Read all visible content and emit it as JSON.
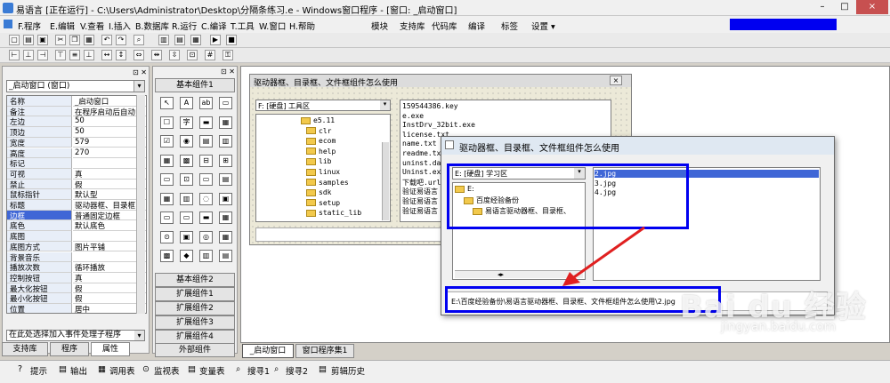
{
  "window": {
    "title": "易语言 [正在运行] - C:\\Users\\Administrator\\Desktop\\分隔条练习.e - Windows窗口程序 - [窗口: _启动窗口]",
    "controls": [
      "–",
      "□",
      "×"
    ]
  },
  "menu": {
    "items": [
      "F.程序",
      "E.编辑",
      "V.查看",
      "I.插入",
      "B.数据库",
      "R.运行",
      "C.编译",
      "T.工具",
      "W.窗口",
      "H.帮助"
    ],
    "right_items": [
      "模块",
      "支持库",
      "代码库",
      "编译",
      "标签",
      "设置 ▾"
    ]
  },
  "properties": {
    "selector": "_启动窗口 (窗口)",
    "rows": [
      {
        "k": "名称",
        "v": "_启动窗口"
      },
      {
        "k": "备注",
        "v": "在程序启动后自动"
      },
      {
        "k": "左边",
        "v": "50"
      },
      {
        "k": "顶边",
        "v": "50"
      },
      {
        "k": "宽度",
        "v": "579"
      },
      {
        "k": "高度",
        "v": "270"
      },
      {
        "k": "标记",
        "v": ""
      },
      {
        "k": "可视",
        "v": "真"
      },
      {
        "k": "禁止",
        "v": "假"
      },
      {
        "k": "鼠标指针",
        "v": "默认型"
      },
      {
        "k": "标题",
        "v": "驱动器框、目录框"
      },
      {
        "k": "边框",
        "v": "普通固定边框",
        "selected": true
      },
      {
        "k": "底色",
        "v": "默认底色"
      },
      {
        "k": "底图",
        "v": ""
      },
      {
        "k": "底图方式",
        "v": "图片平铺"
      },
      {
        "k": "背景音乐",
        "v": ""
      },
      {
        "k": "播放次数",
        "v": "循环播放"
      },
      {
        "k": "控制按钮",
        "v": "真"
      },
      {
        "k": "最大化按钮",
        "v": "假"
      },
      {
        "k": "最小化按钮",
        "v": "假"
      },
      {
        "k": "位置",
        "v": "居中"
      }
    ],
    "event_selector": "在此处选择加入事件处理子程序",
    "tabs": [
      "支持库",
      "程序",
      "属性"
    ]
  },
  "components": {
    "groups_top": "基本组件1",
    "groups_bottom": [
      "基本组件2",
      "扩展组件1",
      "扩展组件2",
      "扩展组件3",
      "扩展组件4",
      "外部组件"
    ]
  },
  "design_form": {
    "title": "驱动器框、目录框、文件框组件怎么使用",
    "drive": "F: [硬盘] 工具区",
    "folders": [
      "e5.11",
      "clr",
      "ecom",
      "help",
      "lib",
      "linux",
      "samples",
      "sdk",
      "setup",
      "static_lib"
    ],
    "files": [
      "159544386.key",
      "e.exe",
      "InstDrv_32bit.exe",
      "license.txt",
      "name.txt",
      "readme.txt",
      "uninst.dat",
      "Uninst.exe",
      "下载吧.url",
      "验证易语言",
      "验证易语言",
      "验证易语言"
    ]
  },
  "running_form": {
    "title": "驱动器框、目录框、文件框组件怎么使用",
    "drive": "E: [硬盘] 学习区",
    "folders": [
      "E:",
      "百度经验备份",
      "易语言驱动器框、目录框、"
    ],
    "files": [
      "2.jpg",
      "3.jpg",
      "4.jpg"
    ],
    "path": "E:\\百度经验备份\\易语言驱动器框、目录框、文件框组件怎么使用\\2.jpg"
  },
  "editor_tabs": [
    "_启动窗口",
    "窗口程序集1"
  ],
  "bottom": {
    "items": [
      "提示",
      "输出",
      "调用表",
      "监视表",
      "变量表",
      "搜寻1",
      "搜寻2",
      "剪辑历史"
    ]
  },
  "watermark": {
    "brand": "Bai du 经验",
    "url": "jingyan.baidu.com"
  },
  "colors": {
    "highlight": "#0000f0",
    "selection": "#3f66d6",
    "arrow": "#e02020"
  }
}
